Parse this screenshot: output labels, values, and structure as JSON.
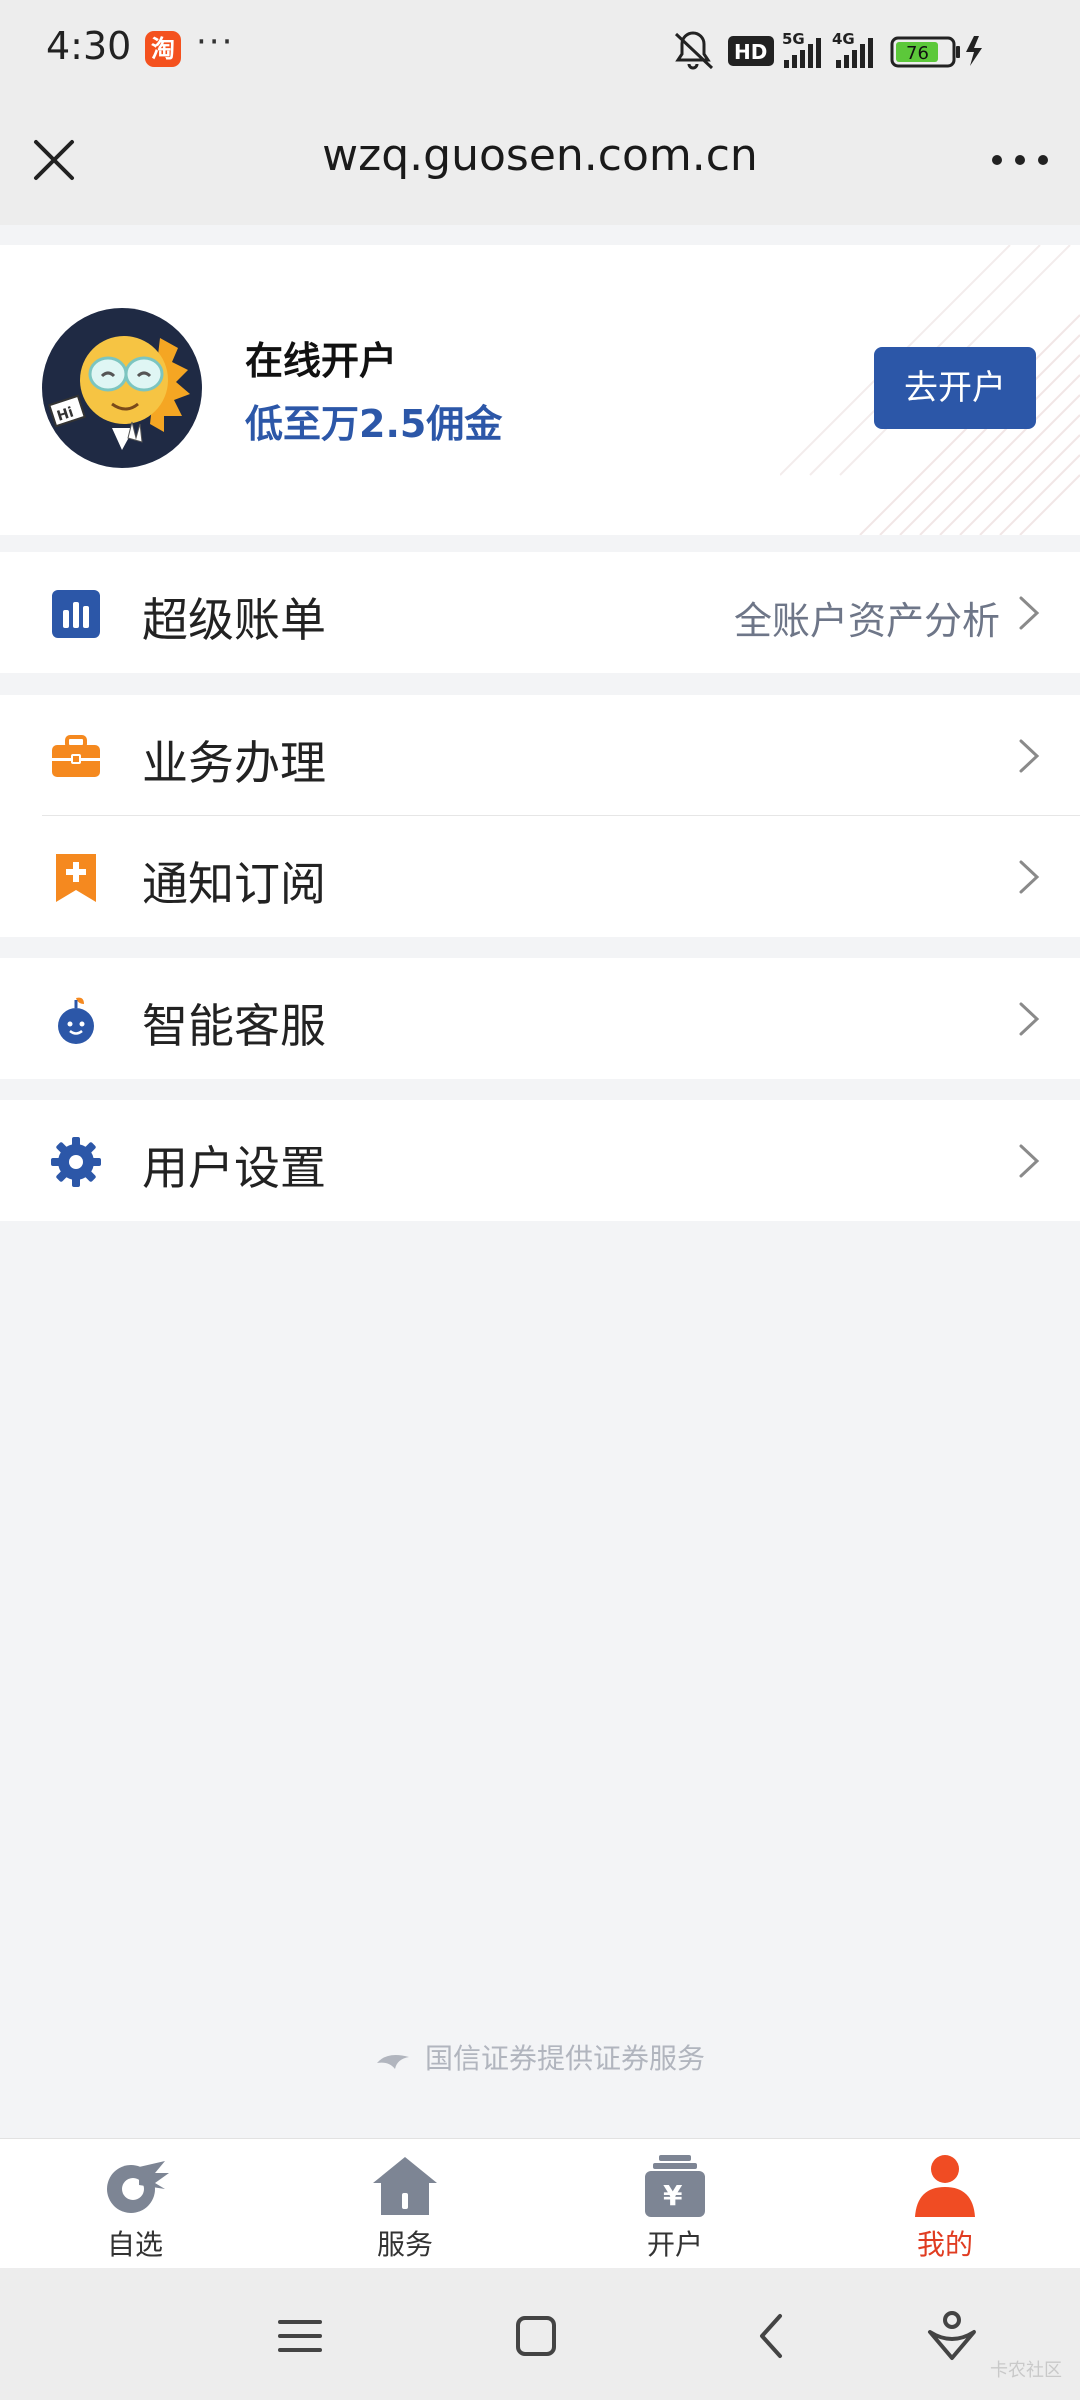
{
  "status_bar": {
    "time": "4:30",
    "app_badge": "淘",
    "more": "···",
    "network_hd": "HD",
    "network_5g": "5G",
    "network_4g": "4G",
    "battery": "76"
  },
  "nav_bar": {
    "title": "wzq.guosen.com.cn"
  },
  "banner": {
    "title": "在线开户",
    "subtitle": "低至万2.5佣金",
    "button_label": "去开户",
    "mascot_sign": "Hi"
  },
  "menu": {
    "super_bill": {
      "label": "超级账单",
      "extra": "全账户资产分析"
    },
    "business": {
      "label": "业务办理"
    },
    "subscription": {
      "label": "通知订阅"
    },
    "service": {
      "label": "智能客服"
    },
    "settings": {
      "label": "用户设置"
    }
  },
  "footer": {
    "note": "国信证券提供证券服务"
  },
  "tabs": [
    {
      "label": "自选",
      "icon": "watchlist-icon",
      "active": false
    },
    {
      "label": "服务",
      "icon": "home-icon",
      "active": false
    },
    {
      "label": "开户",
      "icon": "account-open-icon",
      "active": false
    },
    {
      "label": "我的",
      "icon": "user-icon",
      "active": true
    }
  ],
  "watermark": "卡农社区",
  "colors": {
    "brand_blue": "#2c57a8",
    "orange": "#f5891f",
    "active_tab": "#e03c21",
    "icon_gray": "#7d8594"
  }
}
